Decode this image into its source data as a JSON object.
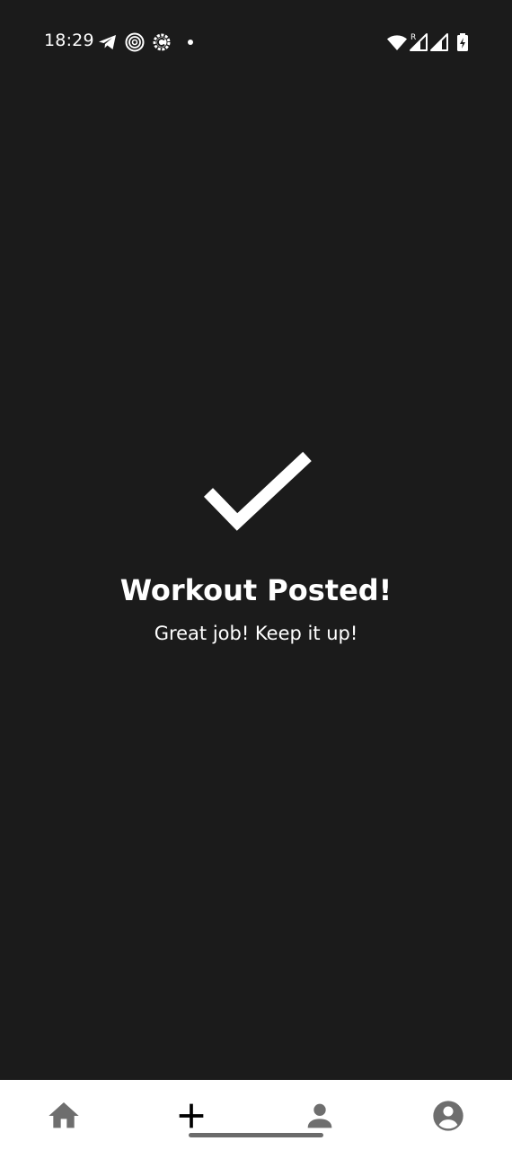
{
  "status_bar": {
    "time": "18:29",
    "left_icons": [
      "telegram-icon",
      "fingerprint-target-icon",
      "gear-c-icon",
      "dot-icon"
    ],
    "right_icons": [
      "wifi-icon",
      "signal-roaming-icon",
      "signal-icon",
      "battery-charging-icon"
    ]
  },
  "success": {
    "icon": "checkmark-icon",
    "title": "Workout Posted!",
    "subtitle": "Great job! Keep it up!"
  },
  "bottom_nav": {
    "items": [
      {
        "icon": "home-icon",
        "active": false
      },
      {
        "icon": "add-icon",
        "active": true
      },
      {
        "icon": "person-icon",
        "active": false
      },
      {
        "icon": "account-circle-icon",
        "active": false
      }
    ]
  },
  "colors": {
    "background": "#1b1b1b",
    "text": "#ffffff",
    "nav_background": "#ffffff",
    "nav_inactive": "#6e6e6e",
    "nav_active": "#000000"
  }
}
